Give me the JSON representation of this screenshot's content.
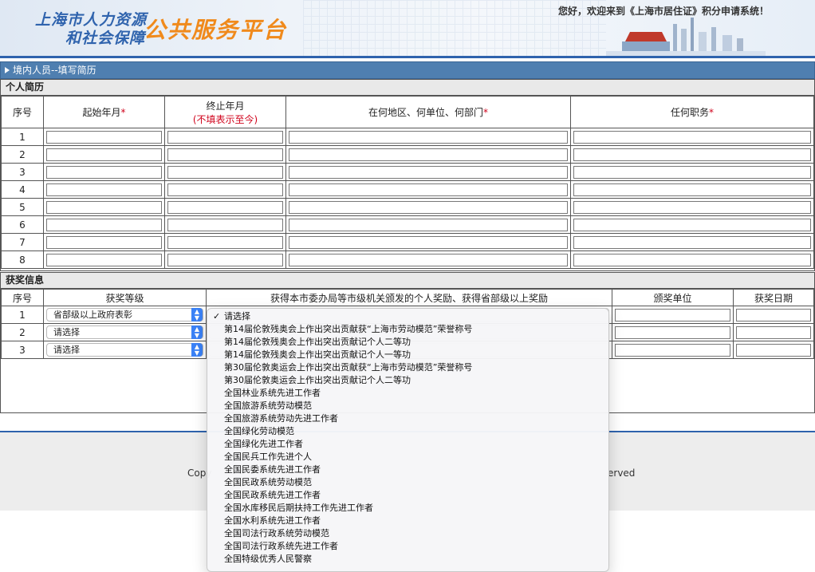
{
  "header": {
    "logo_line1": "上海市人力资源",
    "logo_line2": "和社会保障",
    "logo_platform": "公共服务平台",
    "welcome": "您好，欢迎来到《上海市居住证》积分申请系统！"
  },
  "section_title": "境内人员--填写简历",
  "resume": {
    "heading": "个人简历",
    "col_index": "序号",
    "col_start": "起始年月",
    "col_end": "终止年月",
    "col_end_note": "(不填表示至今)",
    "col_place": "在何地区、何单位、何部门",
    "col_position": "任何职务",
    "required_mark": "*",
    "rows": [
      "1",
      "2",
      "3",
      "4",
      "5",
      "6",
      "7",
      "8"
    ]
  },
  "awards": {
    "heading": "获奖信息",
    "col_index": "序号",
    "col_level": "获奖等级",
    "col_award": "获得本市委办局等市级机关颁发的个人奖励、获得省部级以上奖励",
    "col_issuer": "颁奖单位",
    "col_date": "获奖日期",
    "rows": [
      {
        "index": "1",
        "level": "省部级以上政府表彰"
      },
      {
        "index": "2",
        "level": "请选择"
      },
      {
        "index": "3",
        "level": "请选择"
      }
    ]
  },
  "footer": {
    "copy_left": "Copy",
    "copy_right": "erved"
  },
  "dropdown": {
    "selected": "请选择",
    "options": [
      "请选择",
      "第14届伦敦残奥会上作出突出贡献获“上海市劳动模范”荣誉称号",
      "第14届伦敦残奥会上作出突出贡献记个人二等功",
      "第14届伦敦残奥会上作出突出贡献记个人一等功",
      "第30届伦敦奥运会上作出突出贡献获“上海市劳动模范”荣誉称号",
      "第30届伦敦奥运会上作出突出贡献记个人二等功",
      "全国林业系统先进工作者",
      "全国旅游系统劳动模范",
      "全国旅游系统劳动先进工作者",
      "全国绿化劳动模范",
      "全国绿化先进工作者",
      "全国民兵工作先进个人",
      "全国民委系统先进工作者",
      "全国民政系统劳动模范",
      "全国民政系统先进工作者",
      "全国水库移民后期扶持工作先进工作者",
      "全国水利系统先进工作者",
      "全国司法行政系统劳动模范",
      "全国司法行政系统先进工作者",
      "全国特级优秀人民警察"
    ]
  }
}
